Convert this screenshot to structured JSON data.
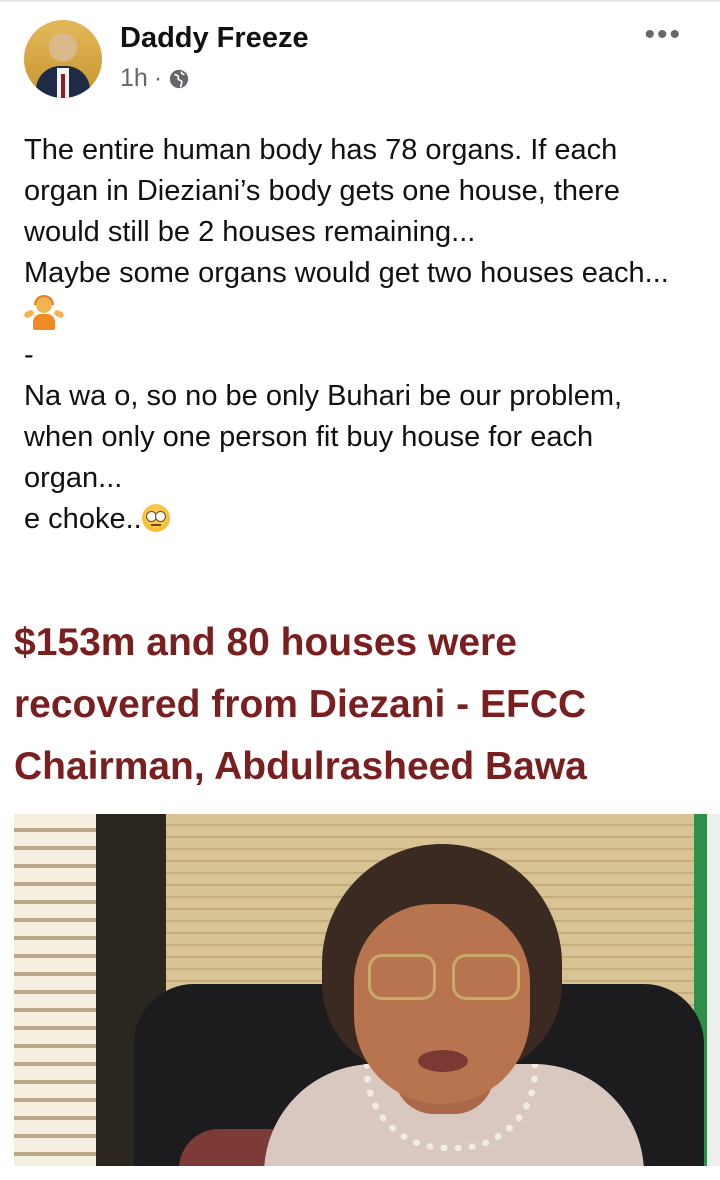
{
  "post": {
    "author": "Daddy Freeze",
    "time": "1h",
    "separator": "·",
    "privacy_icon": "globe-icon",
    "more_icon": "more-options-icon",
    "text": {
      "p1": "The entire human body has 78 organs. If each organ in Dieziani’s body gets one house, there would still be 2 houses remaining...",
      "p2": "Maybe some organs would get two houses each...",
      "emoji1": "shrug-emoji",
      "p3": "-",
      "p4": "Na wa o, so no be only Buhari be our problem, when only one person fit buy house for each organ...",
      "p5": "e choke..",
      "emoji2": "eye-roll-emoji"
    }
  },
  "shared_image": {
    "headline": "$153m and 80 houses were recovered from Diezani - EFCC Chairman, Abdulrasheed Bawa",
    "headline_color": "#7a1f1f"
  }
}
